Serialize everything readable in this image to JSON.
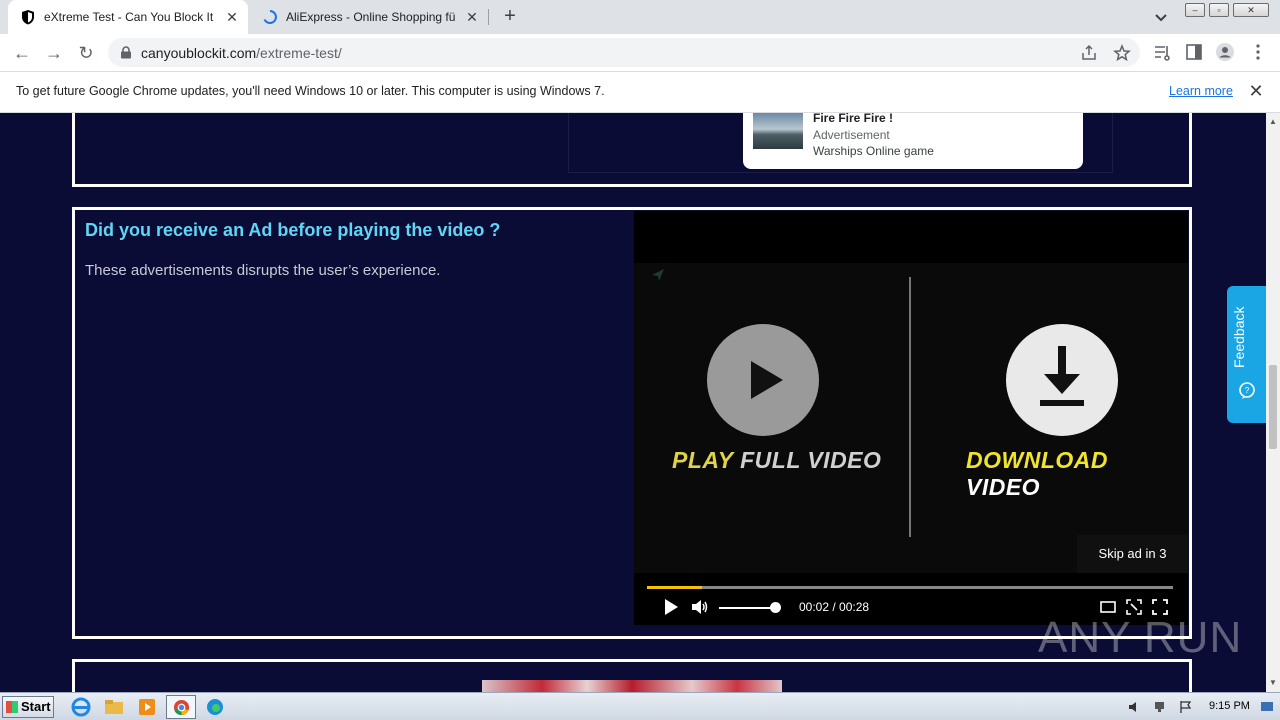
{
  "tabs": [
    {
      "title": "eXtreme Test - Can You Block It ?",
      "active": true
    },
    {
      "title": "AliExpress - Online Shopping für Elektronik",
      "active": false
    }
  ],
  "address": {
    "domain": "canyoublockit.com",
    "path": "/extreme-test/"
  },
  "infobar": {
    "message": "To get future Google Chrome updates, you'll need Windows 10 or later. This computer is using Windows 7.",
    "link": "Learn more"
  },
  "ad_card": {
    "title": "Fire Fire Fire !",
    "label": "Advertisement",
    "subtitle": "Warships Online game"
  },
  "section": {
    "heading": "Did you receive an Ad before playing the video ?",
    "body": "These advertisements disrupts the user’s experience."
  },
  "video": {
    "play_label_a": "PLAY",
    "play_label_b": "FULL VIDEO",
    "download_label_a": "DOWNLOAD",
    "download_label_b": "VIDEO",
    "skip_text": "Skip ad in 3",
    "time": "00:02 / 00:28",
    "progress": 0.105,
    "volume": 1.0
  },
  "feedback": {
    "label": "Feedback"
  },
  "watermark": "ANY RUN",
  "taskbar": {
    "start": "Start",
    "clock": "9:15 PM"
  },
  "colors": {
    "page_bg": "#0b0c35",
    "heading": "#5fd6f5",
    "feedback": "#1aa6e4",
    "progress": "#f2c200"
  }
}
